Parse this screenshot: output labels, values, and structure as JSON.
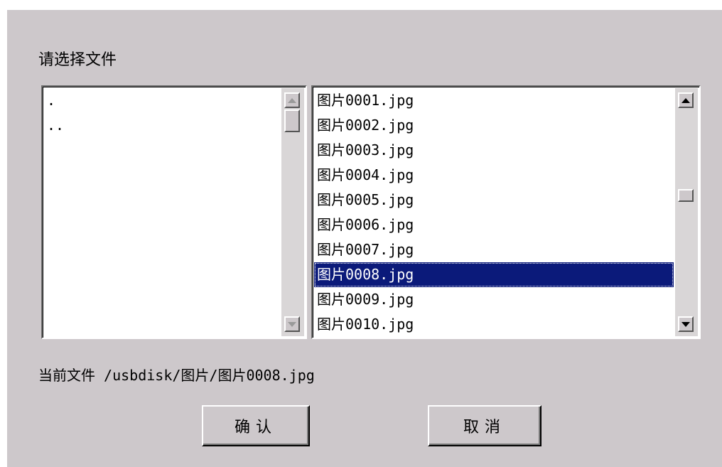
{
  "dialog": {
    "title": "请选择文件",
    "current_file_label": "当前文件",
    "current_file_path": "/usbdisk/图片/图片0008.jpg"
  },
  "directories": [
    ".",
    ".."
  ],
  "files": [
    "图片0001.jpg",
    "图片0002.jpg",
    "图片0003.jpg",
    "图片0004.jpg",
    "图片0005.jpg",
    "图片0006.jpg",
    "图片0007.jpg",
    "图片0008.jpg",
    "图片0009.jpg",
    "图片0010.jpg"
  ],
  "selected_file_index": 7,
  "buttons": {
    "ok": "确认",
    "cancel": "取消"
  },
  "colors": {
    "dialog_bg": "#cdc8cb",
    "selection_bg": "#0b1a7a",
    "selection_text": "#ffffff"
  }
}
